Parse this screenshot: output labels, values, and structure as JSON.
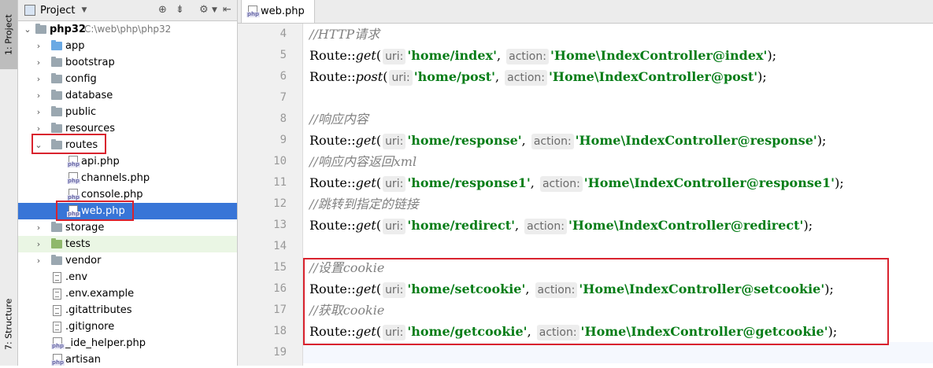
{
  "toolwindows": {
    "project_tab": "1: Project",
    "structure_tab": "7: Structure"
  },
  "project_panel": {
    "title": "Project",
    "root": {
      "name": "php32",
      "path": "C:\\web\\php\\php32"
    },
    "items": [
      {
        "label": "app",
        "type": "folder-blue"
      },
      {
        "label": "bootstrap",
        "type": "folder"
      },
      {
        "label": "config",
        "type": "folder"
      },
      {
        "label": "database",
        "type": "folder"
      },
      {
        "label": "public",
        "type": "folder"
      },
      {
        "label": "resources",
        "type": "folder"
      },
      {
        "label": "routes",
        "type": "folder"
      },
      {
        "label": "api.php",
        "type": "php"
      },
      {
        "label": "channels.php",
        "type": "php"
      },
      {
        "label": "console.php",
        "type": "php"
      },
      {
        "label": "web.php",
        "type": "php"
      },
      {
        "label": "storage",
        "type": "folder"
      },
      {
        "label": "tests",
        "type": "folder-green"
      },
      {
        "label": "vendor",
        "type": "folder"
      },
      {
        "label": ".env",
        "type": "file"
      },
      {
        "label": ".env.example",
        "type": "file"
      },
      {
        "label": ".gitattributes",
        "type": "file"
      },
      {
        "label": ".gitignore",
        "type": "file"
      },
      {
        "label": "_ide_helper.php",
        "type": "php"
      },
      {
        "label": "artisan",
        "type": "php"
      }
    ]
  },
  "editor": {
    "tab_label": "web.php",
    "line_numbers": [
      "4",
      "5",
      "6",
      "7",
      "8",
      "9",
      "10",
      "11",
      "12",
      "13",
      "14",
      "15",
      "16",
      "17",
      "18",
      "19"
    ],
    "tokens": {
      "route": "Route::",
      "get": "get",
      "post": "post",
      "paren_open": "(",
      "sep": ", ",
      "end": ");",
      "uri_hint": "uri:",
      "action_hint": "action:"
    },
    "comments": {
      "l4": "//HTTP请求",
      "l8": "//响应内容",
      "l10": "//响应内容返回xml",
      "l12": "//跳转到指定的链接",
      "l15": "//设置cookie",
      "l17": "//获取cookie"
    },
    "strings": {
      "l5_uri": "'home/index'",
      "l5_action": "'Home\\IndexController@index'",
      "l6_uri": "'home/post'",
      "l6_action": "'Home\\IndexController@post'",
      "l9_uri": "'home/response'",
      "l9_action": "'Home\\IndexController@response'",
      "l11_uri": "'home/response1'",
      "l11_action": "'Home\\IndexController@response1'",
      "l13_uri": "'home/redirect'",
      "l13_action": "'Home\\IndexController@redirect'",
      "l16_uri": "'home/setcookie'",
      "l16_action": "'Home\\IndexController@setcookie'",
      "l18_uri": "'home/getcookie'",
      "l18_action": "'Home\\IndexController@getcookie'"
    }
  }
}
